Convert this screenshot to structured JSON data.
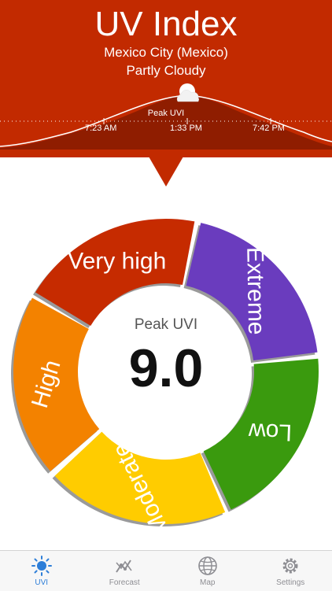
{
  "header": {
    "title": "UV Index",
    "location": "Mexico City (Mexico)",
    "condition": "Partly Cloudy",
    "peak_label": "Peak UVI",
    "times": [
      "7:23 AM",
      "1:33 PM",
      "7:42 PM"
    ]
  },
  "gauge": {
    "center_title": "Peak UVI",
    "value": "9.0",
    "segments": [
      {
        "label": "Very high",
        "color": "#c62b00"
      },
      {
        "label": "Extreme",
        "color": "#6a3cbe"
      },
      {
        "label": "Low",
        "color": "#3a9a0e"
      },
      {
        "label": "Moderate",
        "color": "#ffcc00"
      },
      {
        "label": "High",
        "color": "#f38200"
      }
    ]
  },
  "tabs": [
    {
      "label": "UVI",
      "icon": "sun-icon",
      "active": true
    },
    {
      "label": "Forecast",
      "icon": "chart-line-icon",
      "active": false
    },
    {
      "label": "Map",
      "icon": "globe-icon",
      "active": false
    },
    {
      "label": "Settings",
      "icon": "gear-icon",
      "active": false
    }
  ],
  "colors": {
    "header_bg": "#c22a00",
    "active_tab": "#2d7ed8",
    "inactive_tab": "#8e8e93"
  }
}
